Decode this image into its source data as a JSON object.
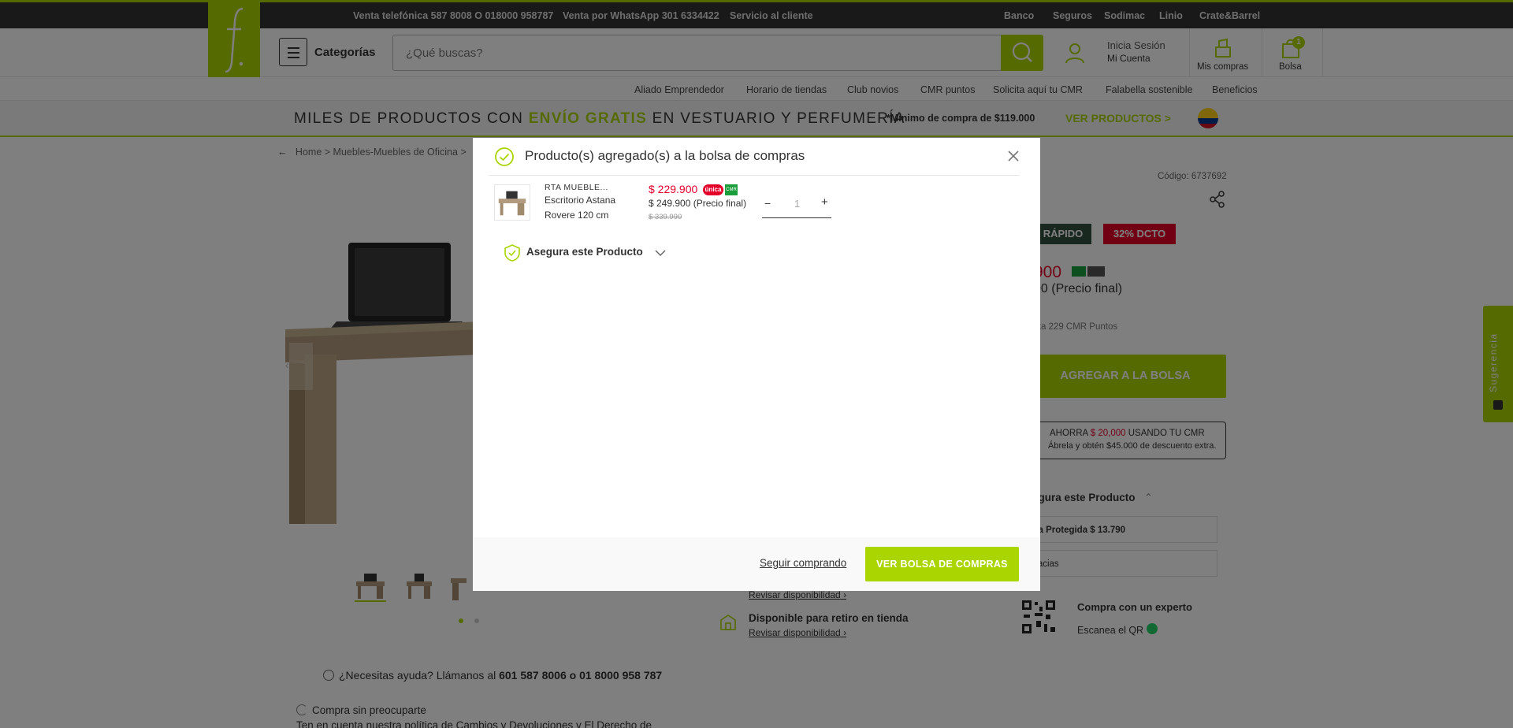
{
  "topbar": {
    "phone": "Venta telefónica 587 8008 O 018000 958787",
    "whatsapp": "Venta por WhatsApp 301 6334422",
    "service": "Servicio al cliente",
    "links": [
      "Banco",
      "Seguros",
      "Sodimac",
      "Linio",
      "Crate&Barrel"
    ]
  },
  "header": {
    "categories_label": "Categorías",
    "search_placeholder": "¿Qué buscas?",
    "login_line1": "Inicia Sesión",
    "login_line2": "Mi Cuenta",
    "purchases_label": "Mis compras",
    "bag_label": "Bolsa",
    "bag_count": "1"
  },
  "subnav": [
    "Aliado Emprendedor",
    "Horario de tiendas",
    "Club novios",
    "CMR puntos",
    "Solicita aquí tu CMR",
    "Falabella sostenible",
    "Beneficios"
  ],
  "promo": {
    "text_before": "MILES DE PRODUCTOS CON ",
    "highlight": "ENVÍO GRATIS",
    "text_after": " EN VESTUARIO Y PERFUMERÍA",
    "minimum": "*Mínimo de compra de $119.000",
    "link": "VER PRODUCTOS >"
  },
  "product_page": {
    "breadcrumb": [
      "Home",
      ">",
      "Muebles-Muebles de Oficina",
      ">"
    ],
    "code": "Código: 6737692",
    "tag_fast": "RÁPIDO",
    "tag_discount": "32% DCTO",
    "price_partial": "900",
    "final_partial": "00 (Precio final)",
    "points": "sta 229 CMR Puntos",
    "add_to_bag": "AGREGAR A LA BOLSA",
    "cmr_line1_a": "AHORRA ",
    "cmr_line1_b": "$ 20,000",
    "cmr_line1_c": " USANDO TU CMR",
    "cmr_line2": "Ábrela y obtén $45.000 de descuento extra.",
    "insure": "egura este Producto",
    "option1": "ra Protegida $ 13.790",
    "option2": "racias",
    "expert_title": "Compra con un experto",
    "expert_scan": "Escanea el QR",
    "check_availability": "Revisar disponibilidad",
    "pickup": "Disponible para retiro en tienda",
    "help_text": "¿Necesitas ayuda? Llámanos al ",
    "help_phone": "601 587 8006 o 01 8000 958 787",
    "worry_free": "Compra sin preocuparte",
    "policy": "Ten en cuenta nuestra política de Cambios y Devoluciones y El Derecho de"
  },
  "feedback_tab": "Sugerencia",
  "modal": {
    "title": "Producto(s) agregado(s) a la bolsa de compras",
    "item": {
      "brand": "RTA MUEBLE...",
      "name_line1": "Escritorio Astana",
      "name_line2": "Rovere 120 cm",
      "price": "$ 229.900",
      "badge_unica": "única",
      "badge_cmr": "CMR",
      "final_price": "$ 249.900 (Precio final)",
      "old_price": "$ 339.990",
      "quantity": "1",
      "minus": "−",
      "plus": "+"
    },
    "insure_label": "Asegura este Producto",
    "continue_label": "Seguir comprando",
    "view_bag_label": "VER BOLSA DE COMPRAS"
  },
  "colors": {
    "brand_green": "#aad500",
    "price_red": "#e4002b",
    "dark_bar": "#333333"
  }
}
